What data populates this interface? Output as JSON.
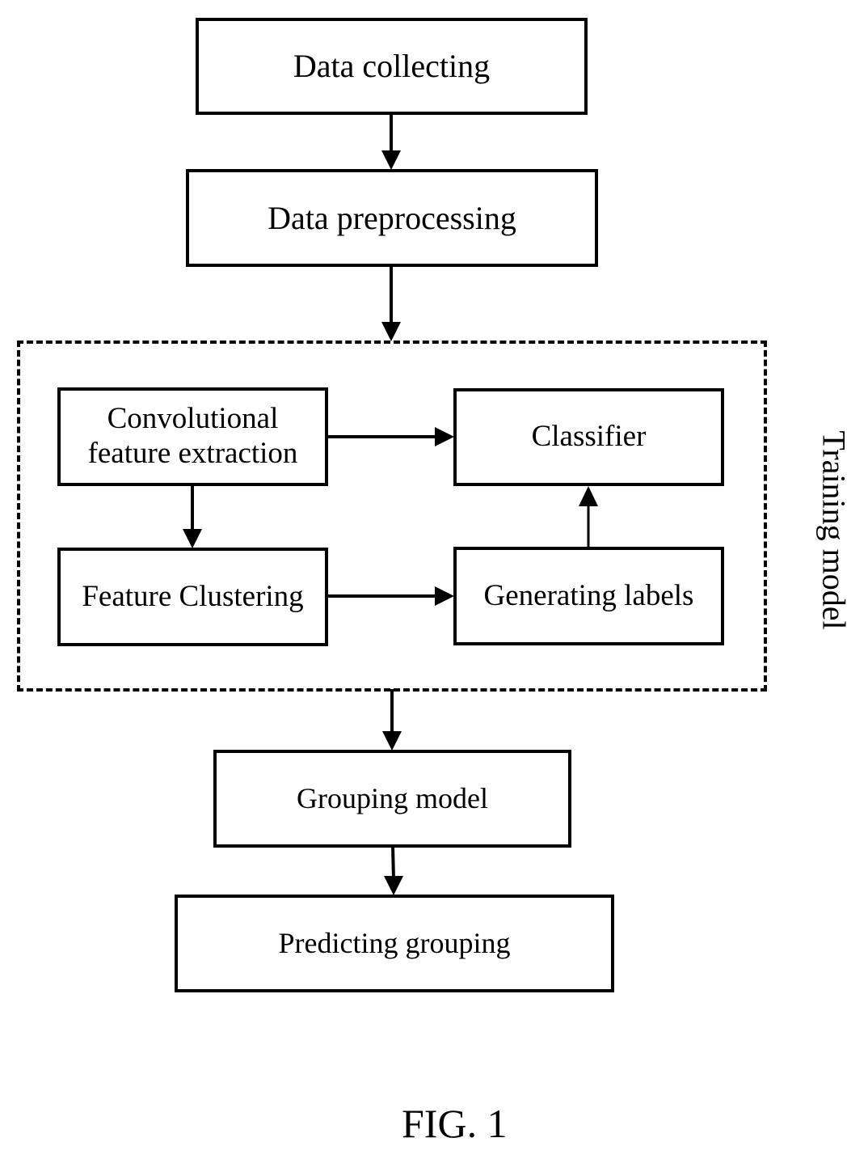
{
  "figure": {
    "caption": "FIG. 1",
    "nodes": {
      "data_collecting": "Data collecting",
      "data_preprocessing": "Data preprocessing",
      "conv_feature_extraction": [
        "Convolutional",
        "feature extraction"
      ],
      "classifier": "Classifier",
      "feature_clustering": "Feature Clustering",
      "generating_labels": "Generating labels",
      "grouping_model": "Grouping model",
      "predicting_grouping": "Predicting grouping"
    },
    "group": {
      "label": "Training model"
    },
    "edges": [
      {
        "from": "Data collecting",
        "to": "Data preprocessing"
      },
      {
        "from": "Data preprocessing",
        "to": "Training model"
      },
      {
        "from": "Convolutional feature extraction",
        "to": "Classifier"
      },
      {
        "from": "Convolutional feature extraction",
        "to": "Feature Clustering"
      },
      {
        "from": "Feature Clustering",
        "to": "Generating labels"
      },
      {
        "from": "Generating labels",
        "to": "Classifier"
      },
      {
        "from": "Training model",
        "to": "Grouping model"
      },
      {
        "from": "Grouping model",
        "to": "Predicting grouping"
      }
    ]
  }
}
